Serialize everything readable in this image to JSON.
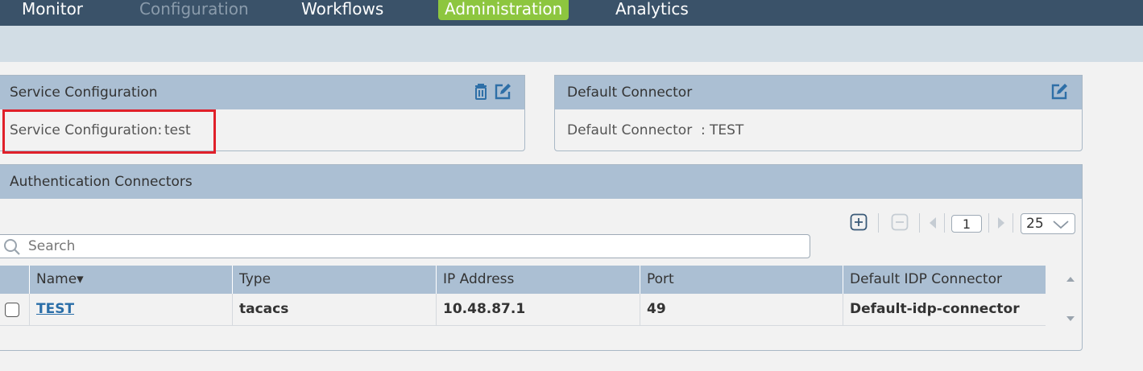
{
  "nav": {
    "items": [
      {
        "label": "Monitor",
        "state": "normal"
      },
      {
        "label": "Configuration",
        "state": "disabled"
      },
      {
        "label": "Workflows",
        "state": "normal"
      },
      {
        "label": "Administration",
        "state": "active"
      },
      {
        "label": "Analytics",
        "state": "normal"
      }
    ]
  },
  "service_config": {
    "title": "Service Configuration",
    "field_label": "Service Configuration:",
    "field_value": "test",
    "icons": [
      "trash-icon",
      "edit-icon"
    ]
  },
  "default_connector": {
    "title": "Default Connector",
    "field_label": "Default Connector",
    "field_sep": ":",
    "field_value": "TEST",
    "icons": [
      "edit-icon"
    ]
  },
  "auth_connectors": {
    "title": "Authentication Connectors",
    "pager": {
      "page": "1",
      "page_size": "25",
      "icons": [
        "add-icon",
        "remove-icon",
        "prev-page-icon",
        "next-page-icon",
        "chevron-down-icon"
      ]
    },
    "search": {
      "placeholder": "Search",
      "value": ""
    },
    "columns": [
      "Name",
      "Type",
      "IP Address",
      "Port",
      "Default IDP Connector"
    ],
    "sort_indicator": "▾",
    "rows": [
      {
        "name": "TEST",
        "type": "tacacs",
        "ip": "10.48.87.1",
        "port": "49",
        "idp": "Default-idp-connector"
      }
    ]
  },
  "colors": {
    "nav_bg": "#3a5269",
    "nav_active": "#8dc63f",
    "panel_header": "#abbfd3",
    "highlight": "#e0202a",
    "link": "#2a6ea8"
  }
}
